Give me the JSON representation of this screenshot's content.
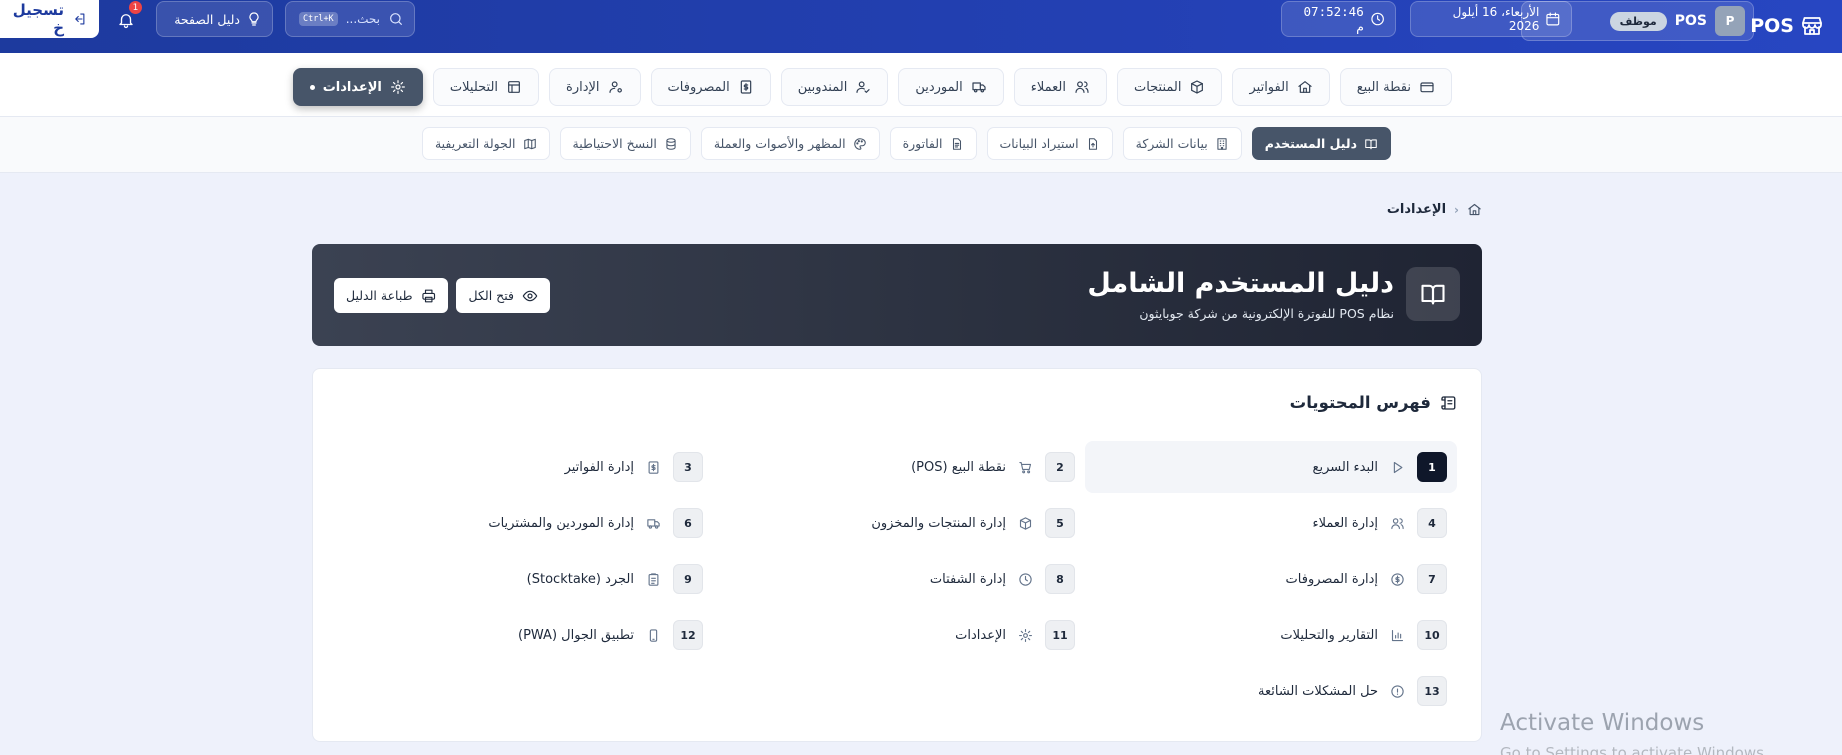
{
  "topbar": {
    "brand": "POS",
    "user_initial": "P",
    "user_name": "POS",
    "role": "موظف",
    "date": "الأربعاء، 16 أيلول 2026",
    "time": "07:52:46 م",
    "search_placeholder": "بحث...",
    "search_shortcut": "Ctrl+K",
    "guide_label": "دليل الصفحة",
    "notification_count": "1",
    "logout_label": "تسجيل خ"
  },
  "main_nav": [
    {
      "label": "نقطة البيع",
      "icon": "credit-card-icon"
    },
    {
      "label": "الفواتير",
      "icon": "home-icon"
    },
    {
      "label": "المنتجات",
      "icon": "box-icon"
    },
    {
      "label": "العملاء",
      "icon": "users-icon"
    },
    {
      "label": "الموردين",
      "icon": "truck-icon"
    },
    {
      "label": "المندوبين",
      "icon": "user-check-icon"
    },
    {
      "label": "المصروفات",
      "icon": "receipt-icon"
    },
    {
      "label": "الإدارة",
      "icon": "user-cog-icon"
    },
    {
      "label": "التحليلات",
      "icon": "layout-icon"
    },
    {
      "label": "الإعدادات",
      "icon": "gear-icon",
      "active": true
    }
  ],
  "sub_nav": [
    {
      "label": "دليل المستخدم",
      "icon": "book-icon",
      "active": true
    },
    {
      "label": "بيانات الشركة",
      "icon": "building-icon"
    },
    {
      "label": "استيراد البيانات",
      "icon": "file-upload-icon"
    },
    {
      "label": "الفاتورة",
      "icon": "file-text-icon"
    },
    {
      "label": "المظهر والأصوات والعملة",
      "icon": "palette-icon"
    },
    {
      "label": "النسخ الاحتياطية",
      "icon": "database-icon"
    },
    {
      "label": "الجولة التعريفية",
      "icon": "map-icon"
    }
  ],
  "breadcrumb": {
    "current": "الإعدادات"
  },
  "hero": {
    "title": "دليل المستخدم الشامل",
    "subtitle": "نظام POS للفوترة الإلكترونية من شركة جوبايثون",
    "open_all_label": "فتح الكل",
    "print_label": "طباعة الدليل"
  },
  "toc": {
    "title": "فهرس المحتويات",
    "items": [
      {
        "num": "1",
        "label": "البدء السريع",
        "icon": "play-icon"
      },
      {
        "num": "2",
        "label": "نقطة البيع (POS)",
        "icon": "cart-icon"
      },
      {
        "num": "3",
        "label": "إدارة الفواتير",
        "icon": "receipt-icon"
      },
      {
        "num": "4",
        "label": "إدارة العملاء",
        "icon": "users-icon"
      },
      {
        "num": "5",
        "label": "إدارة المنتجات والمخزون",
        "icon": "box-icon"
      },
      {
        "num": "6",
        "label": "إدارة الموردين والمشتريات",
        "icon": "truck-icon"
      },
      {
        "num": "7",
        "label": "إدارة المصروفات",
        "icon": "dollar-icon"
      },
      {
        "num": "8",
        "label": "إدارة الشفتات",
        "icon": "clock-icon"
      },
      {
        "num": "9",
        "label": "الجرد (Stocktake)",
        "icon": "clipboard-icon"
      },
      {
        "num": "10",
        "label": "التقارير والتحليلات",
        "icon": "bar-chart-icon"
      },
      {
        "num": "11",
        "label": "الإعدادات",
        "icon": "gear-icon"
      },
      {
        "num": "12",
        "label": "تطبيق الجوال (PWA)",
        "icon": "phone-icon"
      },
      {
        "num": "13",
        "label": "حل المشكلات الشائعة",
        "icon": "help-circle-icon"
      }
    ]
  },
  "watermark": {
    "line1": "Activate Windows",
    "line2": "Go to Settings to activate Windows."
  }
}
